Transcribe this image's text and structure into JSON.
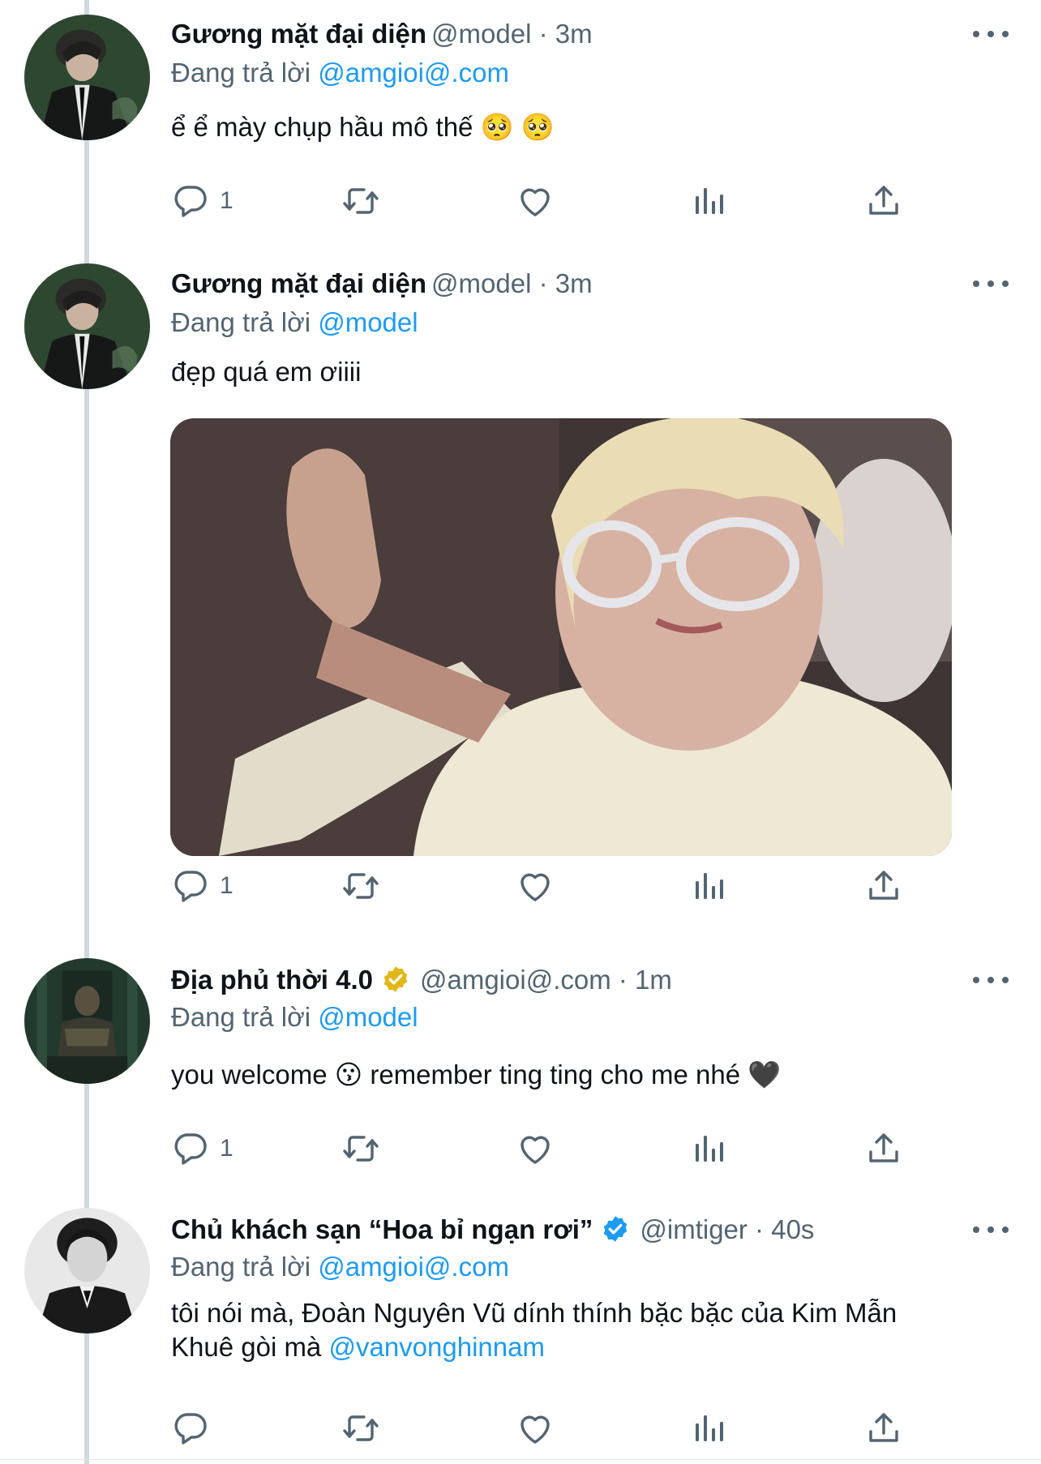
{
  "colors": {
    "accent": "#1d9bf0",
    "muted": "#536471",
    "text": "#0f1419",
    "verified_gold": "#e2b719",
    "verified_blue": "#1d9bf0"
  },
  "tweets": [
    {
      "name": "Gương mặt đại diện",
      "meta": "@model · 3m",
      "reply_prefix": "Đang trả lời",
      "reply_to": "@amgioi@.com",
      "text": "ể ể mày chụp hầu mô thế 🥺 🥺",
      "reply_count": "1",
      "avatar_icon": "avatar-man-in-suit",
      "verified": "none"
    },
    {
      "name": "Gương mặt đại diện",
      "meta": "@model · 3m",
      "reply_prefix": "Đang trả lời",
      "reply_to": "@model",
      "text": "đẹp quá em ơiiii",
      "reply_count": "1",
      "avatar_icon": "avatar-man-in-suit",
      "verified": "none",
      "media": "photo-blond-person-heart-gesture"
    },
    {
      "name": "Địa phủ thời 4.0",
      "meta": "@amgioi@.com · 1m",
      "reply_prefix": "Đang trả lời",
      "reply_to": "@model",
      "text": "you welcome 😗 remember ting ting cho me nhé 🖤",
      "reply_count": "1",
      "avatar_icon": "avatar-throne-figure",
      "verified": "gold"
    },
    {
      "name": "Chủ khách sạn “Hoa bỉ ngạn rơi”",
      "meta": "@imtiger · 40s",
      "reply_prefix": "Đang trả lời",
      "reply_to": "@amgioi@.com",
      "text_line1": "tôi nói mà, Đoàn Nguyên Vũ dính thính bặc bặc của Kim Mẫn",
      "text_line2": "Khuê gòi mà",
      "text_mention": "@vanvonghinnam",
      "reply_count": "",
      "avatar_icon": "avatar-bw-portrait",
      "verified": "blue"
    }
  ],
  "icons": [
    "reply-icon",
    "retweet-icon",
    "like-icon",
    "views-icon",
    "share-icon",
    "more-icon"
  ]
}
